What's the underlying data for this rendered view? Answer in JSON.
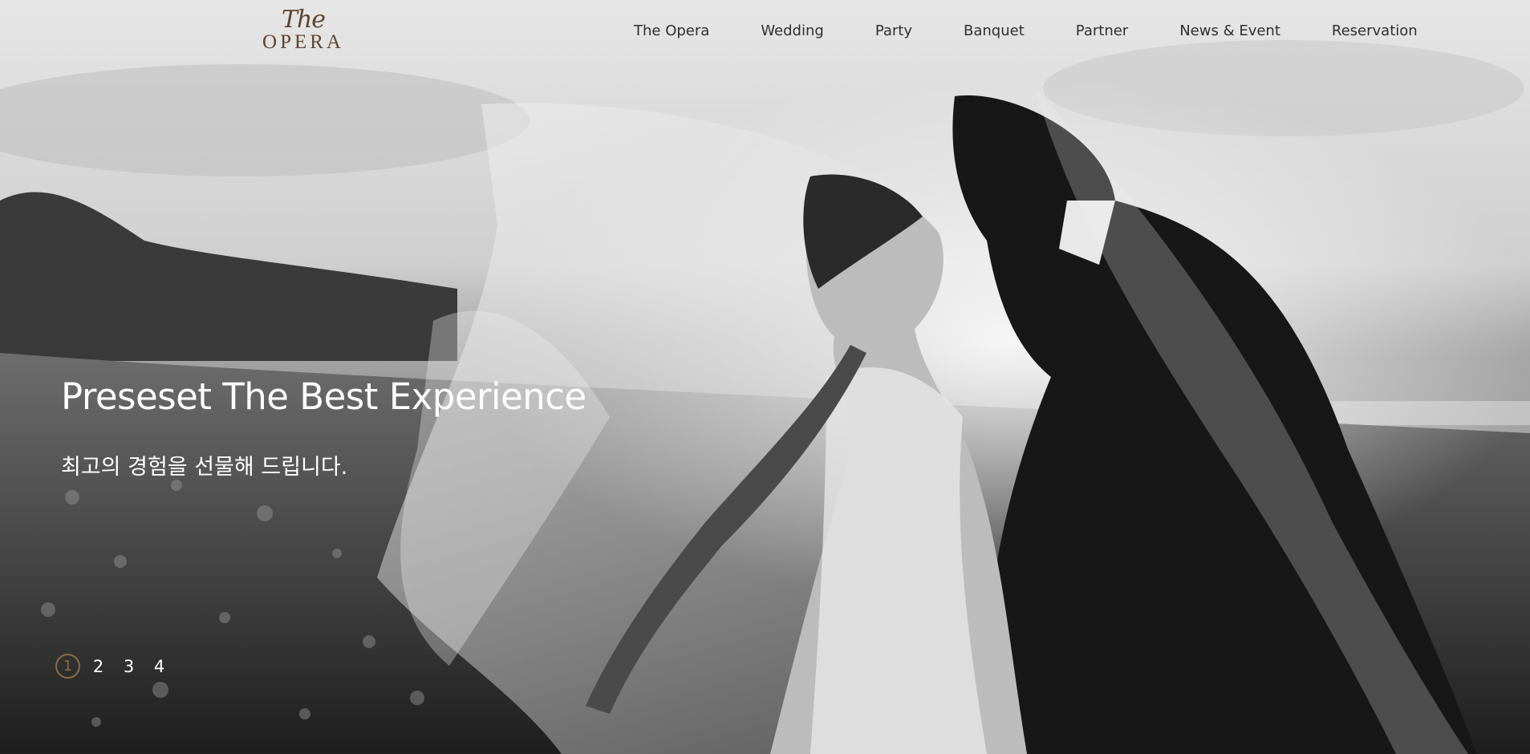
{
  "logo": {
    "script": "The",
    "name": "OPERA"
  },
  "nav": {
    "items": [
      {
        "label": "The Opera"
      },
      {
        "label": "Wedding"
      },
      {
        "label": "Party"
      },
      {
        "label": "Banquet"
      },
      {
        "label": "Partner"
      },
      {
        "label": "News & Event"
      },
      {
        "label": "Reservation"
      }
    ]
  },
  "hero": {
    "headline": "Preseset The Best Experience",
    "subline": "최고의 경험을 선물해 드립니다."
  },
  "pager": {
    "items": [
      "1",
      "2",
      "3",
      "4"
    ],
    "active": "1"
  },
  "colors": {
    "logo": "#5e4330",
    "nav_text": "#2f2f2f",
    "accent": "#8a6b45",
    "hero_text": "#ffffff"
  }
}
